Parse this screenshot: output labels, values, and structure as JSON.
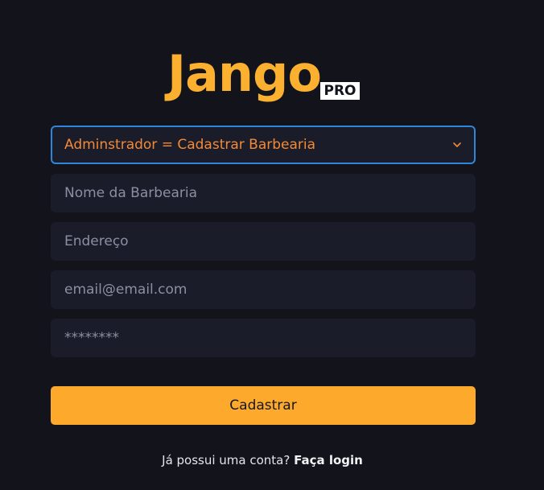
{
  "brand": {
    "name": "Jango",
    "badge": "PRO",
    "color": "#fbb030"
  },
  "form": {
    "role_select": {
      "selected": "Adminstrador = Cadastrar Barbearia",
      "color": "#f28a37",
      "focus_border": "#2f86d8",
      "icon": "chevron-down-icon"
    },
    "fields": {
      "barbershop_name": {
        "placeholder": "Nome da Barbearia",
        "value": ""
      },
      "address": {
        "placeholder": "Endereço",
        "value": ""
      },
      "email": {
        "placeholder": "email@email.com",
        "value": ""
      },
      "password": {
        "placeholder": "********",
        "value": ""
      }
    },
    "submit_label": "Cadastrar",
    "submit_color": "#fca92c"
  },
  "footer": {
    "prompt": "Já possui uma conta?",
    "link_label": "Faça login"
  }
}
